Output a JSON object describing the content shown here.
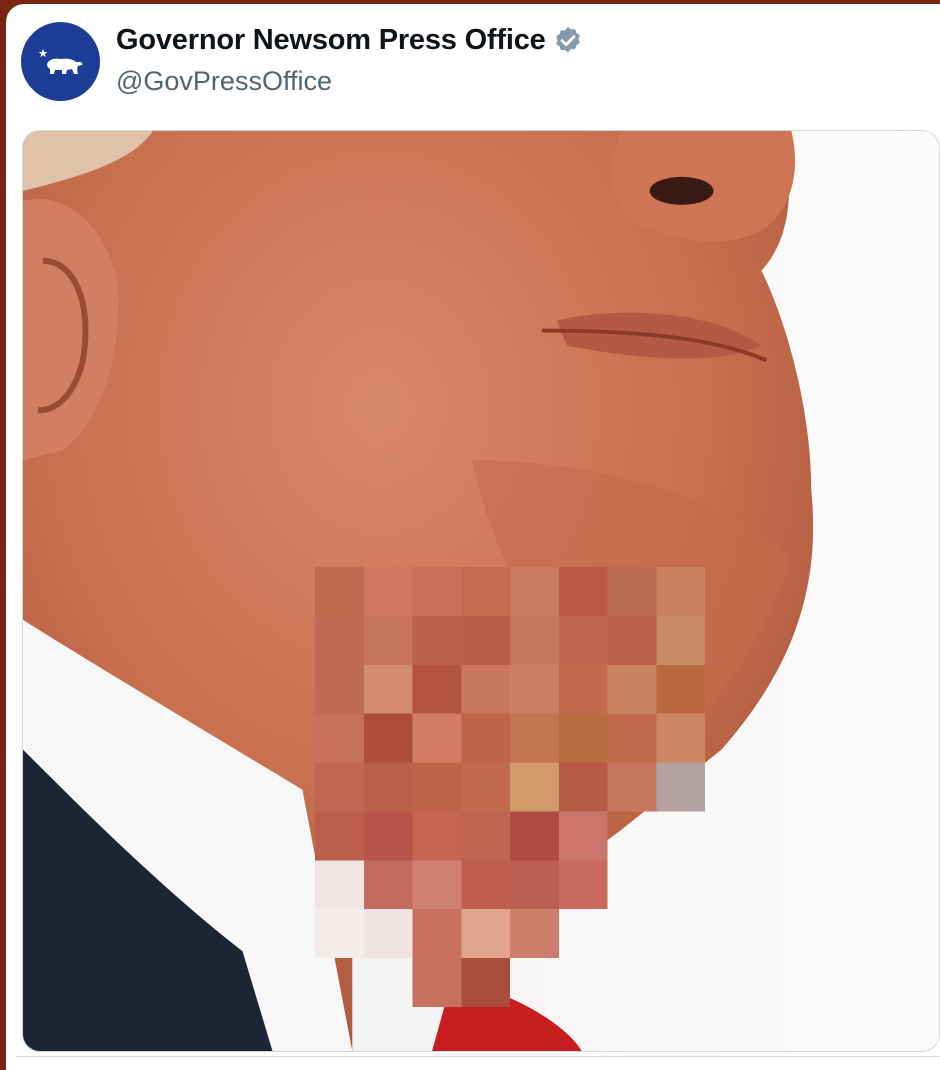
{
  "tweet": {
    "author": {
      "display_name": "Governor Newsom Press Office",
      "handle": "@GovPressOffice",
      "verified": true,
      "avatar_icon": "california-bear-icon",
      "avatar_color": "#1d3c96"
    },
    "media": {
      "type": "photo",
      "pixelated_region": true
    }
  },
  "colors": {
    "verified_badge": "#829aab",
    "handle_text": "#536471",
    "name_text": "#0f1419"
  }
}
